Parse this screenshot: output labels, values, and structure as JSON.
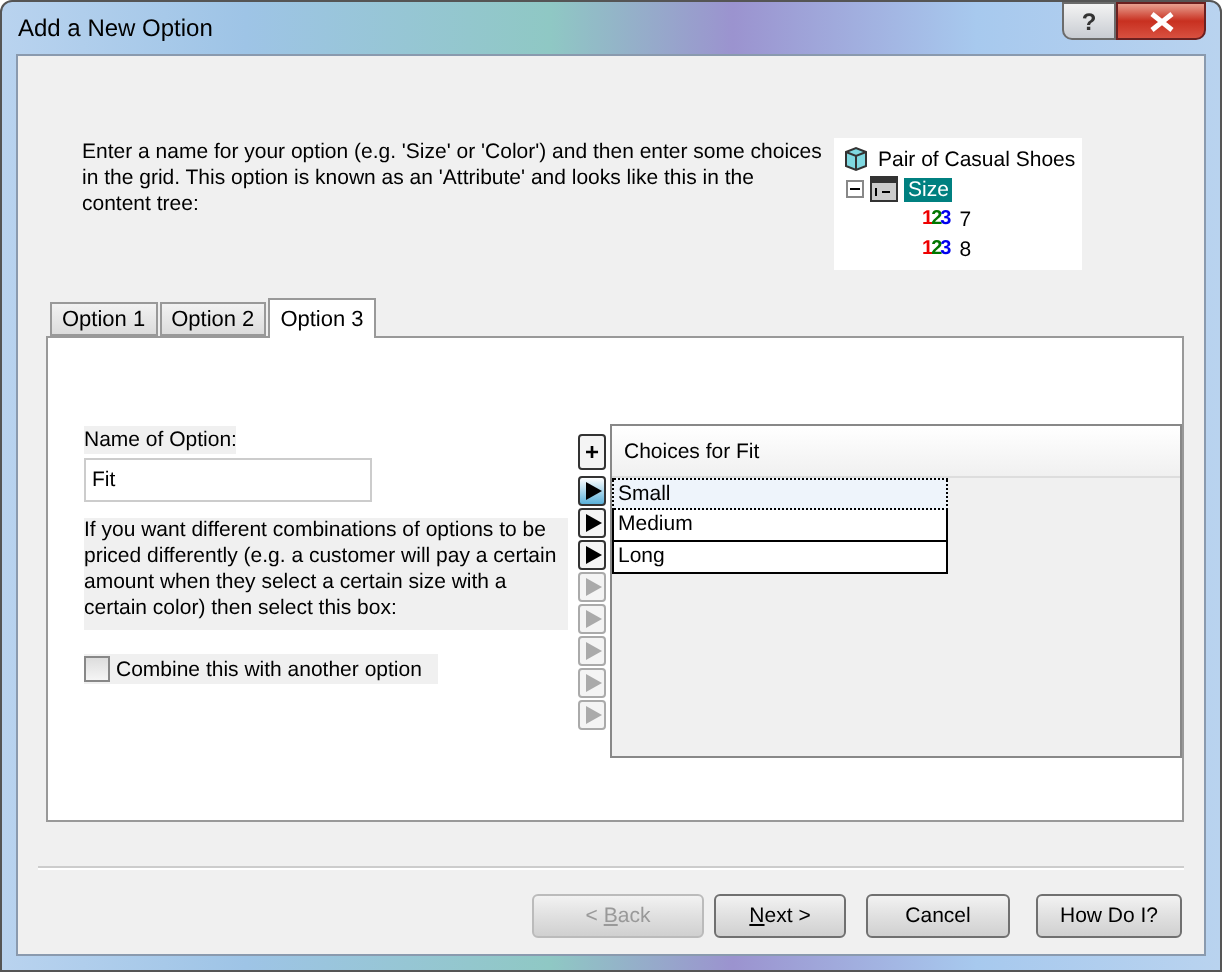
{
  "window": {
    "title": "Add a New Option",
    "help_glyph": "?"
  },
  "intro": "Enter a name for your option (e.g. 'Size' or 'Color') and then enter some choices in the grid.  This option is known as an 'Attribute' and looks like this in the content tree:",
  "tree": {
    "label": "Pair of Casual Shoes",
    "children": [
      {
        "label": "Size",
        "selected": true,
        "expanded": true,
        "children": [
          {
            "label": "7",
            "icon_text": "123"
          },
          {
            "label": "8",
            "icon_text": "123"
          }
        ]
      }
    ]
  },
  "tabs": [
    {
      "label": "Option 1",
      "selected": false
    },
    {
      "label": "Option 2",
      "selected": false
    },
    {
      "label": "Option 3",
      "selected": true
    }
  ],
  "name_label": "Name of Option:",
  "name_value": "Fit",
  "description": "If you want different combinations of options to be priced differently (e.g. a customer will pay a certain amount when they select a certain size with a certain color) then select this box:",
  "combine": {
    "label": "Combine this with another option",
    "checked": false
  },
  "grid": {
    "add_glyph": "+",
    "header": "Choices for Fit",
    "rows": [
      {
        "value": "Small",
        "selected": true
      },
      {
        "value": "Medium",
        "selected": false
      },
      {
        "value": "Long",
        "selected": false
      }
    ],
    "markers": [
      {
        "enabled": true,
        "selected": true
      },
      {
        "enabled": true,
        "selected": false
      },
      {
        "enabled": true,
        "selected": false
      },
      {
        "enabled": false,
        "selected": false
      },
      {
        "enabled": false,
        "selected": false
      },
      {
        "enabled": false,
        "selected": false
      },
      {
        "enabled": false,
        "selected": false
      },
      {
        "enabled": false,
        "selected": false
      }
    ]
  },
  "buttons": [
    {
      "pre": "< ",
      "key": "B",
      "post": "ack",
      "disabled": true
    },
    {
      "key": "N",
      "post": "ext >",
      "disabled": false
    },
    {
      "pre": "Cancel",
      "disabled": false
    },
    {
      "pre": "How Do I?",
      "disabled": false
    }
  ]
}
